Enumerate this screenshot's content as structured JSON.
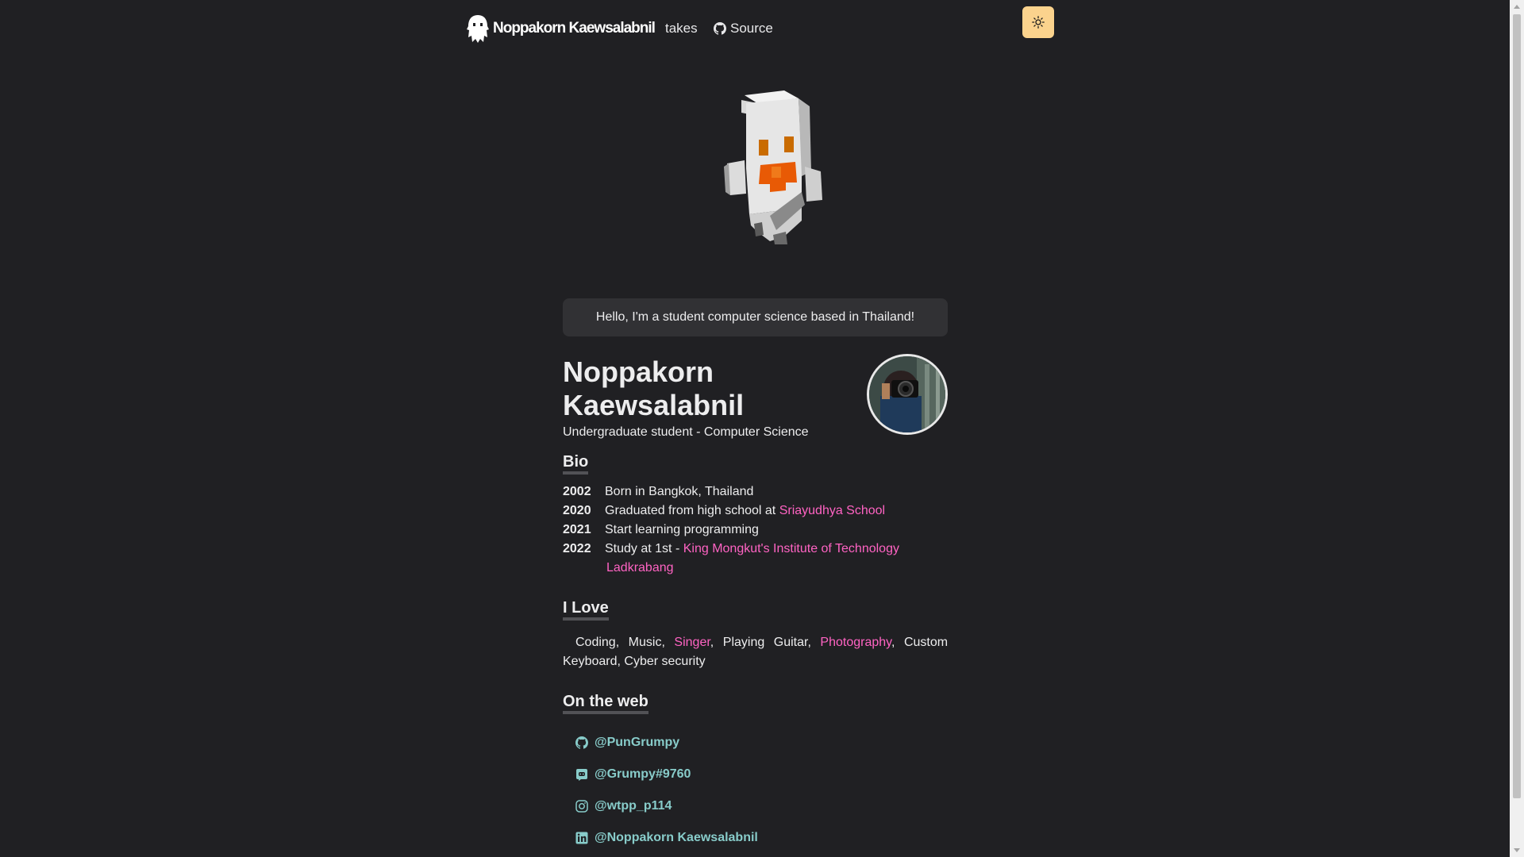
{
  "nav": {
    "brand": "Noppakorn Kaewsalabnil",
    "links": [
      {
        "label": "takes"
      },
      {
        "label": "Source",
        "icon": "github-icon"
      }
    ],
    "theme_toggle_icon": "sun-icon",
    "theme_toggle_color": "#fbd38d"
  },
  "intro": "Hello, I'm a student computer science based in Thailand!",
  "profile": {
    "name": "Noppakorn Kaewsalabnil",
    "role": "Undergraduate student - Computer Science"
  },
  "bio": {
    "heading": "Bio",
    "entries": [
      {
        "year": "2002",
        "text": "Born in Bangkok, Thailand"
      },
      {
        "year": "2020",
        "text": "Graduated from high school at ",
        "link": "Sriayudhya School"
      },
      {
        "year": "2021",
        "text": "Start learning programming"
      },
      {
        "year": "2022",
        "text": "Study at 1st - ",
        "link": "King Mongkut's Institute of Technology",
        "link2": "Ladkrabang"
      }
    ]
  },
  "love": {
    "heading": "I Love",
    "items": [
      "Coding",
      "Music",
      "Singer",
      "Playing Guitar",
      "Photography",
      "Custom Keyboard",
      "Cyber security"
    ]
  },
  "web": {
    "heading": "On the web",
    "items": [
      {
        "icon": "github-icon",
        "label": "@PunGrumpy"
      },
      {
        "icon": "discord-icon",
        "label": "@Grumpy#9760"
      },
      {
        "icon": "instagram-icon",
        "label": "@wtpp_p114"
      },
      {
        "icon": "linkedin-icon",
        "label": "@Noppakorn Kaewsalabnil"
      }
    ]
  },
  "colors": {
    "background": "#202023",
    "accent_pink": "#ff63c3",
    "link_teal": "#88ccca"
  }
}
